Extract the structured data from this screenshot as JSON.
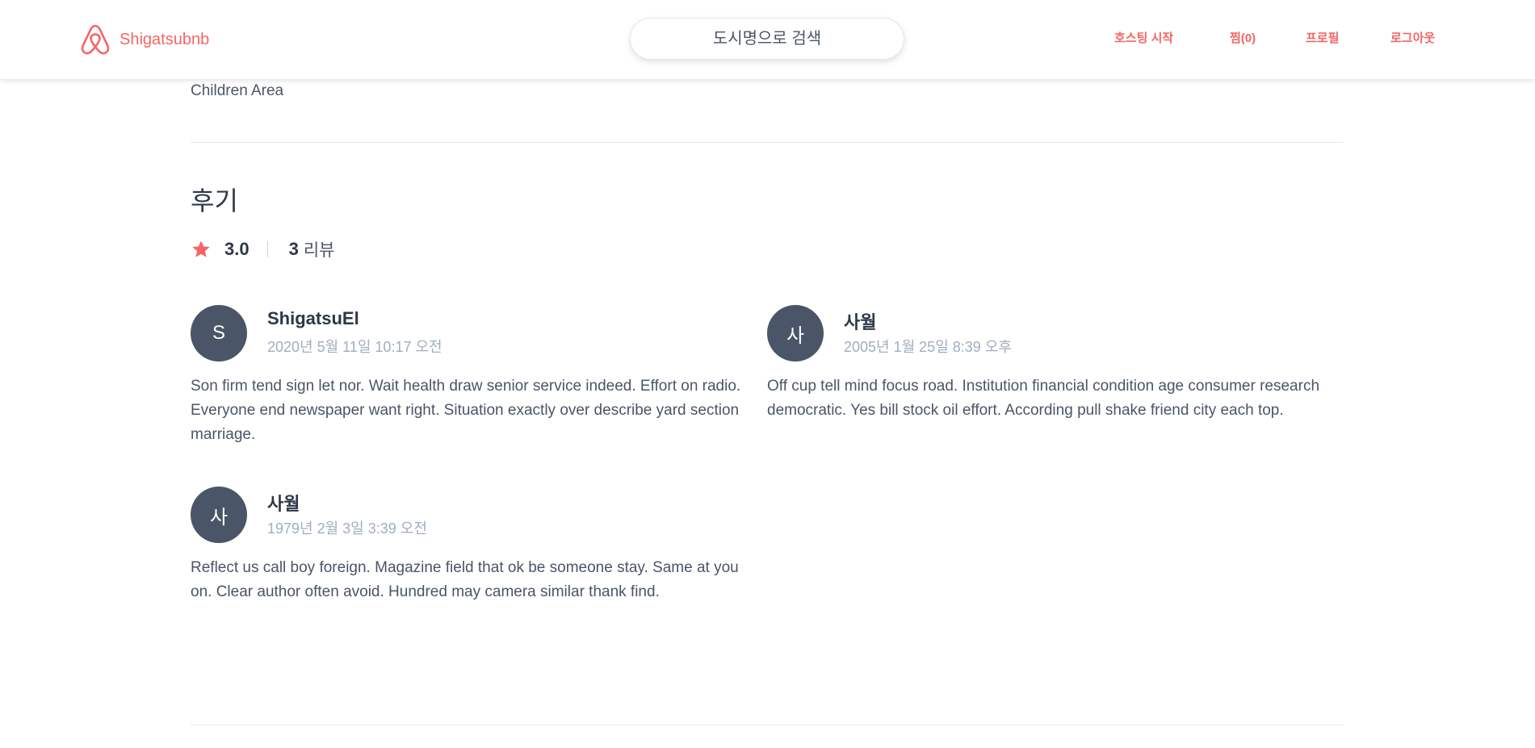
{
  "header": {
    "brand_name": "Shigatsubnb",
    "brand_color": "#f56565",
    "logo_icon": "airbnb-logo-icon",
    "search_placeholder": "도시명으로 검색",
    "nav": {
      "hosting": "호스팅 시작",
      "wishlist": "찜(0)",
      "profile": "프로필",
      "logout": "로그아웃"
    }
  },
  "main": {
    "amenity_last": "Children Area",
    "reviews": {
      "title": "후기",
      "rating_icon": "star-icon",
      "rating_color": "#f56565",
      "rating": "3.0",
      "count": "3",
      "count_label": "리뷰",
      "items": [
        {
          "initial": "S",
          "name": "ShigatsuEl",
          "date": "2020년 5월 11일 10:17 오전",
          "text": "Son firm tend sign let nor. Wait health draw senior service indeed. Effort on radio. Everyone end newspaper want right. Situation exactly over describe yard section marriage."
        },
        {
          "initial": "사",
          "name": "사월",
          "date": "2005년 1월 25일 8:39 오후",
          "text": "Off cup tell mind focus road. Institution financial condition age consumer research democratic. Yes bill stock oil effort. According pull shake friend city each top."
        },
        {
          "initial": "사",
          "name": "사월",
          "date": "1979년 2월 3일 3:39 오전",
          "text": "Reflect us call boy foreign. Magazine field that ok be someone stay. Same at you on. Clear author often avoid. Hundred may camera similar thank find."
        }
      ]
    }
  }
}
